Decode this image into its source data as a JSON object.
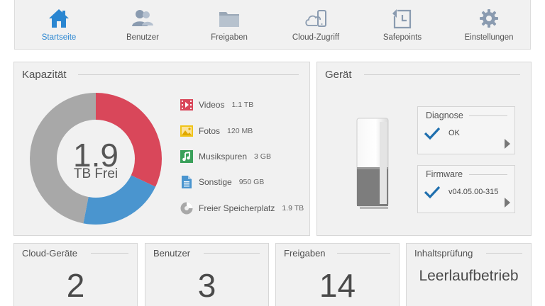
{
  "nav": {
    "items": [
      {
        "label": "Startseite",
        "icon": "home-icon",
        "active": true
      },
      {
        "label": "Benutzer",
        "icon": "users-icon",
        "active": false
      },
      {
        "label": "Freigaben",
        "icon": "folder-icon",
        "active": false
      },
      {
        "label": "Cloud-Zugriff",
        "icon": "cloud-device-icon",
        "active": false
      },
      {
        "label": "Safepoints",
        "icon": "safepoint-icon",
        "active": false
      },
      {
        "label": "Einstellungen",
        "icon": "gear-icon",
        "active": false
      }
    ]
  },
  "capacity": {
    "title": "Kapazität",
    "free_value": "1.9",
    "free_unit": "TB Frei",
    "donut_share": {
      "Videos": 0.32,
      "Sonstige": 0.21,
      "Freier Speicherplatz": 0.47
    },
    "legend": [
      {
        "name": "Videos",
        "value": "1.1 TB",
        "icon": "video-icon",
        "color": "#d9475a"
      },
      {
        "name": "Fotos",
        "value": "120 MB",
        "icon": "photo-icon",
        "color": "#f0c419"
      },
      {
        "name": "Musikspuren",
        "value": "3 GB",
        "icon": "music-icon",
        "color": "#3aa05a"
      },
      {
        "name": "Sonstige",
        "value": "950 GB",
        "icon": "document-icon",
        "color": "#4a95cf"
      },
      {
        "name": "Freier Speicherplatz",
        "value": "1.9 TB",
        "icon": "free-space-icon",
        "color": "#a8a8a8"
      }
    ]
  },
  "device": {
    "title": "Gerät",
    "diagnose": {
      "title": "Diagnose",
      "value": "OK"
    },
    "firmware": {
      "title": "Firmware",
      "value": "v04.05.00-315"
    }
  },
  "stats": [
    {
      "title": "Cloud-Geräte",
      "value": "2"
    },
    {
      "title": "Benutzer",
      "value": "3"
    },
    {
      "title": "Freigaben",
      "value": "14"
    },
    {
      "title": "Inhaltsprüfung",
      "value": "Leerlaufbetrieb"
    }
  ],
  "colors": {
    "accent": "#2a86d1",
    "check": "#1f6fae"
  }
}
